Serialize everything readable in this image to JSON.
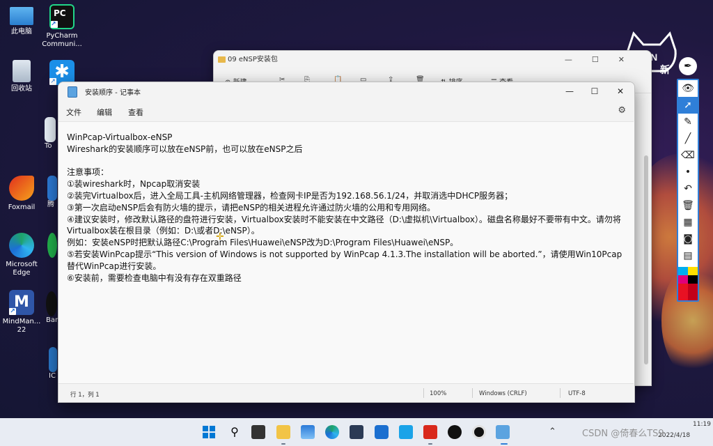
{
  "desktop": {
    "icons": [
      {
        "label": "此电脑",
        "icon": "monitor-icon"
      },
      {
        "label": "PyCharm Communi...",
        "icon": "pycharm-icon",
        "short": "PC"
      },
      {
        "label": "回收站",
        "icon": "recycle-bin-icon"
      },
      {
        "label": "",
        "icon": "app-blue-star-icon"
      },
      {
        "label": "Foxmail",
        "icon": "foxmail-icon"
      },
      {
        "label": "Microsoft Edge",
        "icon": "edge-icon"
      },
      {
        "label": "MindMan... 22",
        "icon": "mindmanager-icon"
      },
      {
        "label": "To",
        "icon": "partial-icon"
      },
      {
        "label": "腾",
        "icon": "partial-icon"
      },
      {
        "label": "Ban",
        "icon": "partial-icon"
      },
      {
        "label": "IC",
        "icon": "partial-icon"
      }
    ]
  },
  "explorer": {
    "title": "09 eNSP安装包",
    "toolbar": {
      "new_label": "新建",
      "sort_label": "排序",
      "view_label": "查看"
    }
  },
  "notepad": {
    "title": "安装顺序 - 记事本",
    "menu": [
      "文件",
      "编辑",
      "查看"
    ],
    "content": "WinPcap-Virtualbox-eNSP\nWireshark的安装顺序可以放在eNSP前，也可以放在eNSP之后\n\n注意事项：\n①装wireshark时，Npcap取消安装\n②装完Virtualbox后，进入全局工具-主机网络管理器，检查网卡IP是否为192.168.56.1/24，并取消选中DHCP服务器；\n③第一次启动eNSP后会有防火墙的提示，请把eNSP的相关进程允许通过防火墙的公用和专用网络。\n④建议安装时，修改默认路径的盘符进行安装，Virtualbox安装时不能安装在中文路径（D:\\虚拟机\\Virtualbox）。磁盘名称最好不要带有中文。请勿将Virtualbox装在根目录（例如：D:\\或者D:\\eNSP）。\n例如：安装eNSP时把默认路径C:\\Program Files\\Huawei\\eNSP改为D:\\Program Files\\Huawei\\eNSP。\n⑤若安装WinPcap提示“This version of Windows is not supported by WinPcap 4.1.3.The installation will be aborted.”，请使用Win10Pcap替代WinPcap进行安装。\n⑥安装前，需要检查电脑中有没有存在双重路径",
    "status": {
      "position": "行 1，列 1",
      "zoom": "100%",
      "line_ending": "Windows (CRLF)",
      "encoding": "UTF-8"
    }
  },
  "branding": {
    "foxin": "OXIN",
    "foxin_cn": "新"
  },
  "taskbar": {
    "time": "11:19",
    "date": "2022/4/18",
    "watermark": "CSDN @倚春么TS9"
  }
}
